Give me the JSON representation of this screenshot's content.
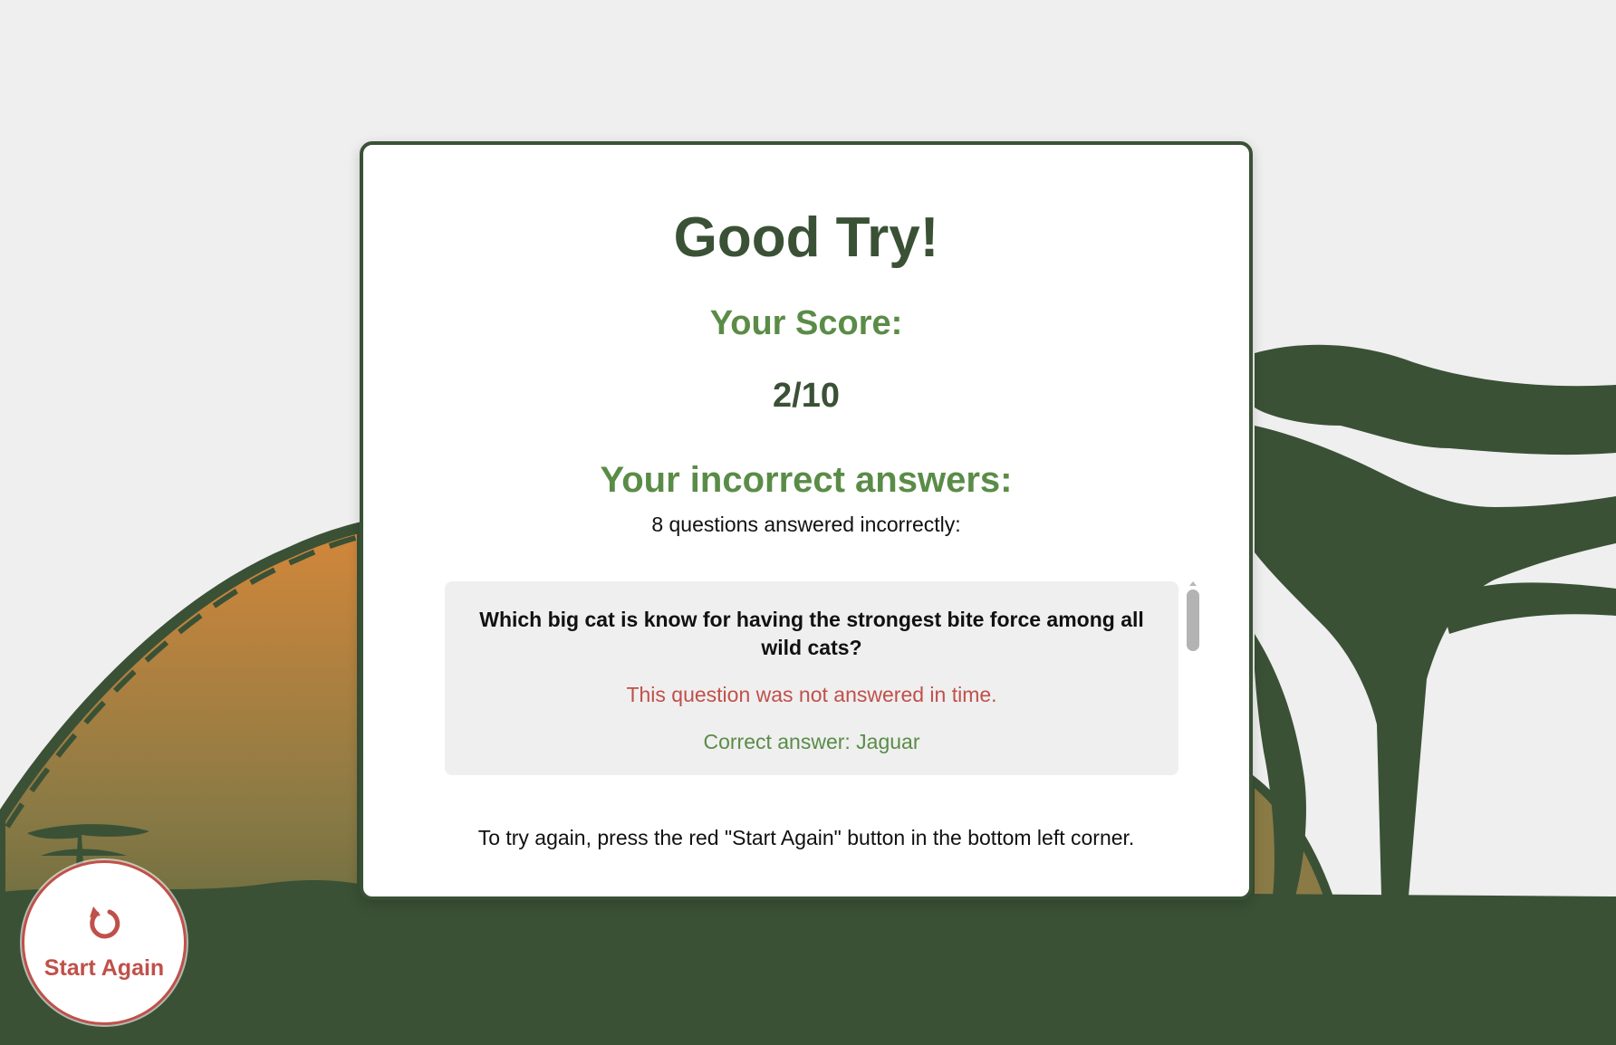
{
  "result": {
    "title": "Good Try!",
    "score_label": "Your Score:",
    "score_value": "2/10"
  },
  "incorrect": {
    "heading": "Your incorrect answers:",
    "count_text": "8 questions answered incorrectly:",
    "items": [
      {
        "question": "Which big cat is know for having the strongest bite force among all wild cats?",
        "status": "This question was not answered in time.",
        "correct_answer": "Correct answer:  Jaguar"
      }
    ]
  },
  "instructions": "To try again, press the red \"Start Again\" button in the bottom left corner.",
  "start_again": {
    "label": "Start Again",
    "icon": "restart-icon"
  },
  "colors": {
    "dark_green": "#3a5136",
    "accent_green": "#5a8c47",
    "red": "#c0504a",
    "background": "#efefef",
    "hill_orange": "#d3873a"
  }
}
